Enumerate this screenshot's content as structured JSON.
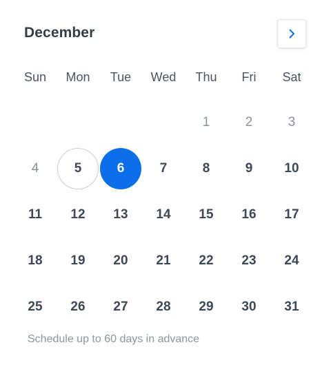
{
  "header": {
    "month": "December",
    "next_icon": "chevron-right-icon",
    "accent_color": "#0a6fe8"
  },
  "weekdays": [
    "Sun",
    "Mon",
    "Tue",
    "Wed",
    "Thu",
    "Fri",
    "Sat"
  ],
  "days": [
    {
      "label": "",
      "state": "empty"
    },
    {
      "label": "",
      "state": "empty"
    },
    {
      "label": "",
      "state": "empty"
    },
    {
      "label": "",
      "state": "empty"
    },
    {
      "label": "1",
      "state": "disabled"
    },
    {
      "label": "2",
      "state": "disabled"
    },
    {
      "label": "3",
      "state": "disabled"
    },
    {
      "label": "4",
      "state": "disabled"
    },
    {
      "label": "5",
      "state": "today"
    },
    {
      "label": "6",
      "state": "selected"
    },
    {
      "label": "7",
      "state": "available"
    },
    {
      "label": "8",
      "state": "available"
    },
    {
      "label": "9",
      "state": "available"
    },
    {
      "label": "10",
      "state": "available"
    },
    {
      "label": "11",
      "state": "available"
    },
    {
      "label": "12",
      "state": "available"
    },
    {
      "label": "13",
      "state": "available"
    },
    {
      "label": "14",
      "state": "available"
    },
    {
      "label": "15",
      "state": "available"
    },
    {
      "label": "16",
      "state": "available"
    },
    {
      "label": "17",
      "state": "available"
    },
    {
      "label": "18",
      "state": "available"
    },
    {
      "label": "19",
      "state": "available"
    },
    {
      "label": "20",
      "state": "available"
    },
    {
      "label": "21",
      "state": "available"
    },
    {
      "label": "22",
      "state": "available"
    },
    {
      "label": "23",
      "state": "available"
    },
    {
      "label": "24",
      "state": "available"
    },
    {
      "label": "25",
      "state": "available"
    },
    {
      "label": "26",
      "state": "available"
    },
    {
      "label": "27",
      "state": "available"
    },
    {
      "label": "28",
      "state": "available"
    },
    {
      "label": "29",
      "state": "available"
    },
    {
      "label": "30",
      "state": "available"
    },
    {
      "label": "31",
      "state": "available"
    }
  ],
  "footer": {
    "note": "Schedule up to 60 days in advance"
  }
}
